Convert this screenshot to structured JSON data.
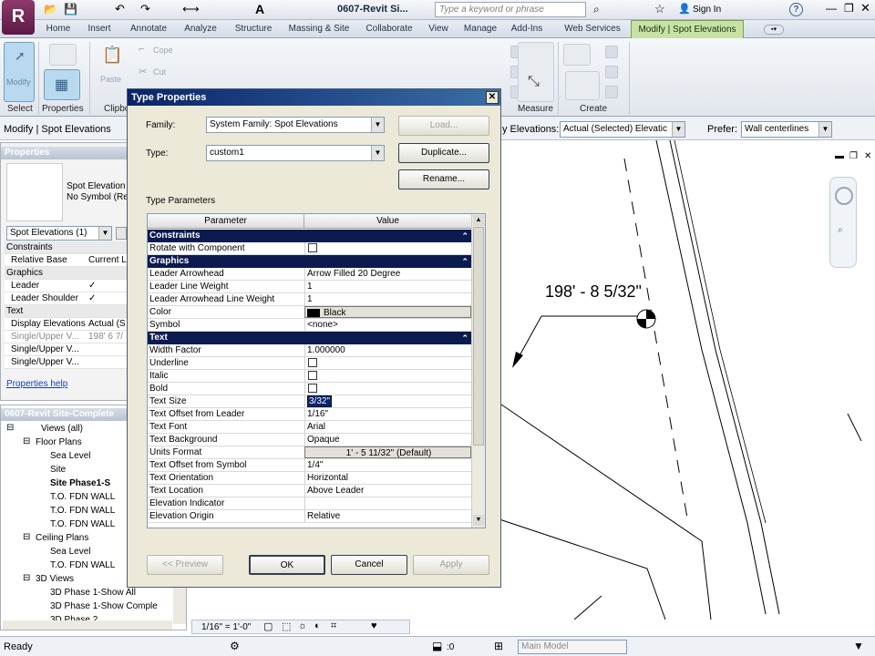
{
  "title_bar": {
    "doc_title": "0607-Revit Si...",
    "search_placeholder": "Type a keyword or phrase",
    "sign_in": "Sign In",
    "help": "?"
  },
  "ribbon_tabs": [
    "Home",
    "Insert",
    "Annotate",
    "Analyze",
    "Structure",
    "Massing & Site",
    "Collaborate",
    "View",
    "Manage",
    "Add-Ins",
    "Web Services",
    "Modify | Spot Elevations"
  ],
  "ribbon": {
    "modify_label": "Modify",
    "paste_label": "Paste",
    "cope_label": "Cope",
    "cut_label": "Cut",
    "panels": [
      "Select",
      "Properties",
      "Clipbo",
      "Measure",
      "Create"
    ]
  },
  "options_bar": {
    "context": "Modify | Spot Elevations",
    "display_label": "y Elevations:",
    "display_value": "Actual (Selected) Elevatic",
    "prefer_label": "Prefer:",
    "prefer_value": "Wall centerlines"
  },
  "properties": {
    "title": "Properties",
    "type_name": "Spot Elevation",
    "type_sub": "No Symbol (Re",
    "selector": "Spot Elevations (1)",
    "rows": [
      {
        "label": "Constraints",
        "value": "",
        "kind": "group"
      },
      {
        "label": "Relative Base",
        "value": "Current L",
        "kind": "row"
      },
      {
        "label": "Graphics",
        "value": "",
        "kind": "group"
      },
      {
        "label": "Leader",
        "value": "✓",
        "kind": "row"
      },
      {
        "label": "Leader Shoulder",
        "value": "✓",
        "kind": "row"
      },
      {
        "label": "Text",
        "value": "",
        "kind": "group"
      },
      {
        "label": "Display Elevations",
        "value": "Actual (S",
        "kind": "row"
      },
      {
        "label": "Single/Upper V...",
        "value": "198' 6 7/",
        "kind": "dim"
      },
      {
        "label": "Single/Upper V...",
        "value": "",
        "kind": "row"
      },
      {
        "label": "Single/Upper V...",
        "value": "",
        "kind": "row"
      }
    ],
    "help_link": "Properties help"
  },
  "browser": {
    "title": "0607-Revit Site-Complete",
    "items": [
      {
        "label": "Views (all)",
        "indent": 0,
        "expander": "⊟",
        "bold": false
      },
      {
        "label": "Floor Plans",
        "indent": 1,
        "expander": "⊟",
        "bold": false
      },
      {
        "label": "Sea Level",
        "indent": 2,
        "expander": "",
        "bold": false
      },
      {
        "label": "Site",
        "indent": 2,
        "expander": "",
        "bold": false
      },
      {
        "label": "Site Phase1-S",
        "indent": 2,
        "expander": "",
        "bold": true
      },
      {
        "label": "T.O. FDN WALL",
        "indent": 2,
        "expander": "",
        "bold": false
      },
      {
        "label": "T.O. FDN WALL",
        "indent": 2,
        "expander": "",
        "bold": false
      },
      {
        "label": "T.O. FDN WALL",
        "indent": 2,
        "expander": "",
        "bold": false
      },
      {
        "label": "Ceiling Plans",
        "indent": 1,
        "expander": "⊟",
        "bold": false
      },
      {
        "label": "Sea Level",
        "indent": 2,
        "expander": "",
        "bold": false
      },
      {
        "label": "T.O. FDN WALL",
        "indent": 2,
        "expander": "",
        "bold": false
      },
      {
        "label": "3D Views",
        "indent": 1,
        "expander": "⊟",
        "bold": false
      },
      {
        "label": "3D Phase 1-Show All",
        "indent": 2,
        "expander": "",
        "bold": false
      },
      {
        "label": "3D Phase 1-Show Comple",
        "indent": 2,
        "expander": "",
        "bold": false
      },
      {
        "label": "3D Phase 2",
        "indent": 2,
        "expander": "",
        "bold": false
      }
    ]
  },
  "dialog": {
    "title": "Type Properties",
    "family_label": "Family:",
    "family_value": "System Family: Spot Elevations",
    "type_label": "Type:",
    "type_value": "custom1",
    "load_btn": "Load...",
    "duplicate_btn": "Duplicate...",
    "rename_btn": "Rename...",
    "type_params_label": "Type Parameters",
    "col_param": "Parameter",
    "col_value": "Value",
    "params": [
      {
        "kind": "group",
        "label": "Constraints"
      },
      {
        "kind": "check",
        "label": "Rotate with Component",
        "checked": false
      },
      {
        "kind": "group",
        "label": "Graphics"
      },
      {
        "kind": "text",
        "label": "Leader Arrowhead",
        "value": "Arrow Filled 20 Degree"
      },
      {
        "kind": "text",
        "label": "Leader Line Weight",
        "value": "1"
      },
      {
        "kind": "text",
        "label": "Leader Arrowhead Line Weight",
        "value": "1"
      },
      {
        "kind": "color",
        "label": "Color",
        "value": "Black"
      },
      {
        "kind": "text",
        "label": "Symbol",
        "value": "<none>"
      },
      {
        "kind": "group",
        "label": "Text"
      },
      {
        "kind": "text",
        "label": "Width Factor",
        "value": "1.000000"
      },
      {
        "kind": "check",
        "label": "Underline",
        "checked": false
      },
      {
        "kind": "check",
        "label": "Italic",
        "checked": false
      },
      {
        "kind": "check",
        "label": "Bold",
        "checked": false
      },
      {
        "kind": "edit",
        "label": "Text Size",
        "value": "3/32\""
      },
      {
        "kind": "text",
        "label": "Text Offset from Leader",
        "value": "1/16\""
      },
      {
        "kind": "text",
        "label": "Text Font",
        "value": "Arial"
      },
      {
        "kind": "text",
        "label": "Text Background",
        "value": "Opaque"
      },
      {
        "kind": "button",
        "label": "Units Format",
        "value": "1' - 5 11/32\" (Default)"
      },
      {
        "kind": "text",
        "label": "Text Offset from Symbol",
        "value": "1/4\""
      },
      {
        "kind": "text",
        "label": "Text Orientation",
        "value": "Horizontal"
      },
      {
        "kind": "text",
        "label": "Text Location",
        "value": "Above Leader"
      },
      {
        "kind": "text",
        "label": "Elevation Indicator",
        "value": ""
      },
      {
        "kind": "text",
        "label": "Elevation Origin",
        "value": "Relative"
      }
    ],
    "preview_btn": "<< Preview",
    "ok_btn": "OK",
    "cancel_btn": "Cancel",
    "apply_btn": "Apply"
  },
  "canvas": {
    "elevation_text": "198' - 8 5/32\""
  },
  "view_bar": {
    "scale": "1/16\" = 1'-0\""
  },
  "status_bar": {
    "status": "Ready",
    "count": ":0",
    "model": "Main Model"
  }
}
